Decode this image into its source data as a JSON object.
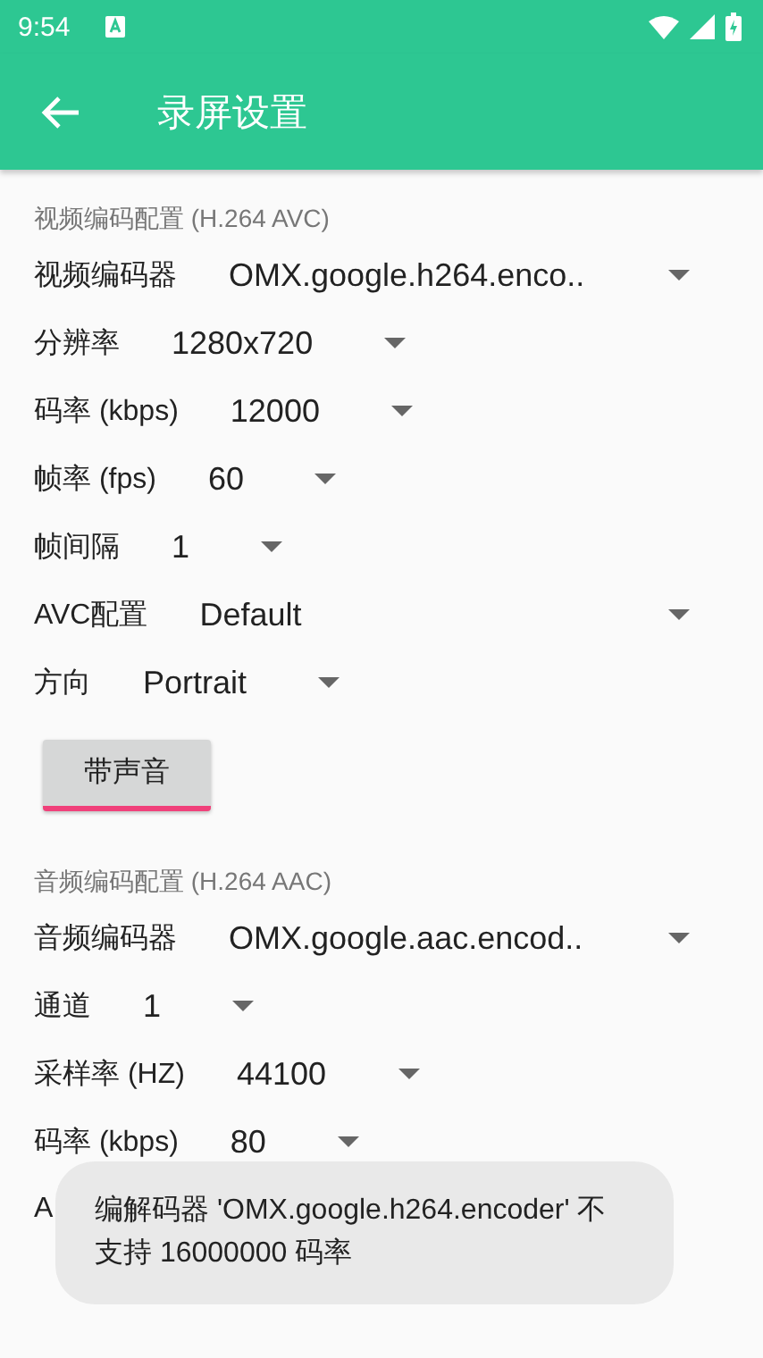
{
  "status_bar": {
    "time": "9:54"
  },
  "app_bar": {
    "title": "录屏设置"
  },
  "sections": [
    {
      "header": "视频编码配置 (H.264 AVC)",
      "rows": [
        {
          "label": "视频编码器",
          "value": "OMX.google.h264.enco.."
        },
        {
          "label": "分辨率",
          "value": "1280x720"
        },
        {
          "label": "码率 (kbps)",
          "value": "12000"
        },
        {
          "label": "帧率 (fps)",
          "value": "60"
        },
        {
          "label": "帧间隔",
          "value": "1"
        },
        {
          "label": "AVC配置",
          "value": "Default"
        },
        {
          "label": "方向",
          "value": "Portrait"
        }
      ],
      "toggle": {
        "label": "带声音",
        "on": true
      }
    },
    {
      "header": "音频编码配置 (H.264 AAC)",
      "rows": [
        {
          "label": "音频编码器",
          "value": "OMX.google.aac.encod.."
        },
        {
          "label": "通道",
          "value": "1"
        },
        {
          "label": "采样率 (HZ)",
          "value": "44100"
        },
        {
          "label": "码率 (kbps)",
          "value": "80"
        },
        {
          "label": "A"
        }
      ]
    }
  ],
  "toast": {
    "text": "编解码器 'OMX.google.h264.encoder' 不支持 16000000 码率"
  }
}
